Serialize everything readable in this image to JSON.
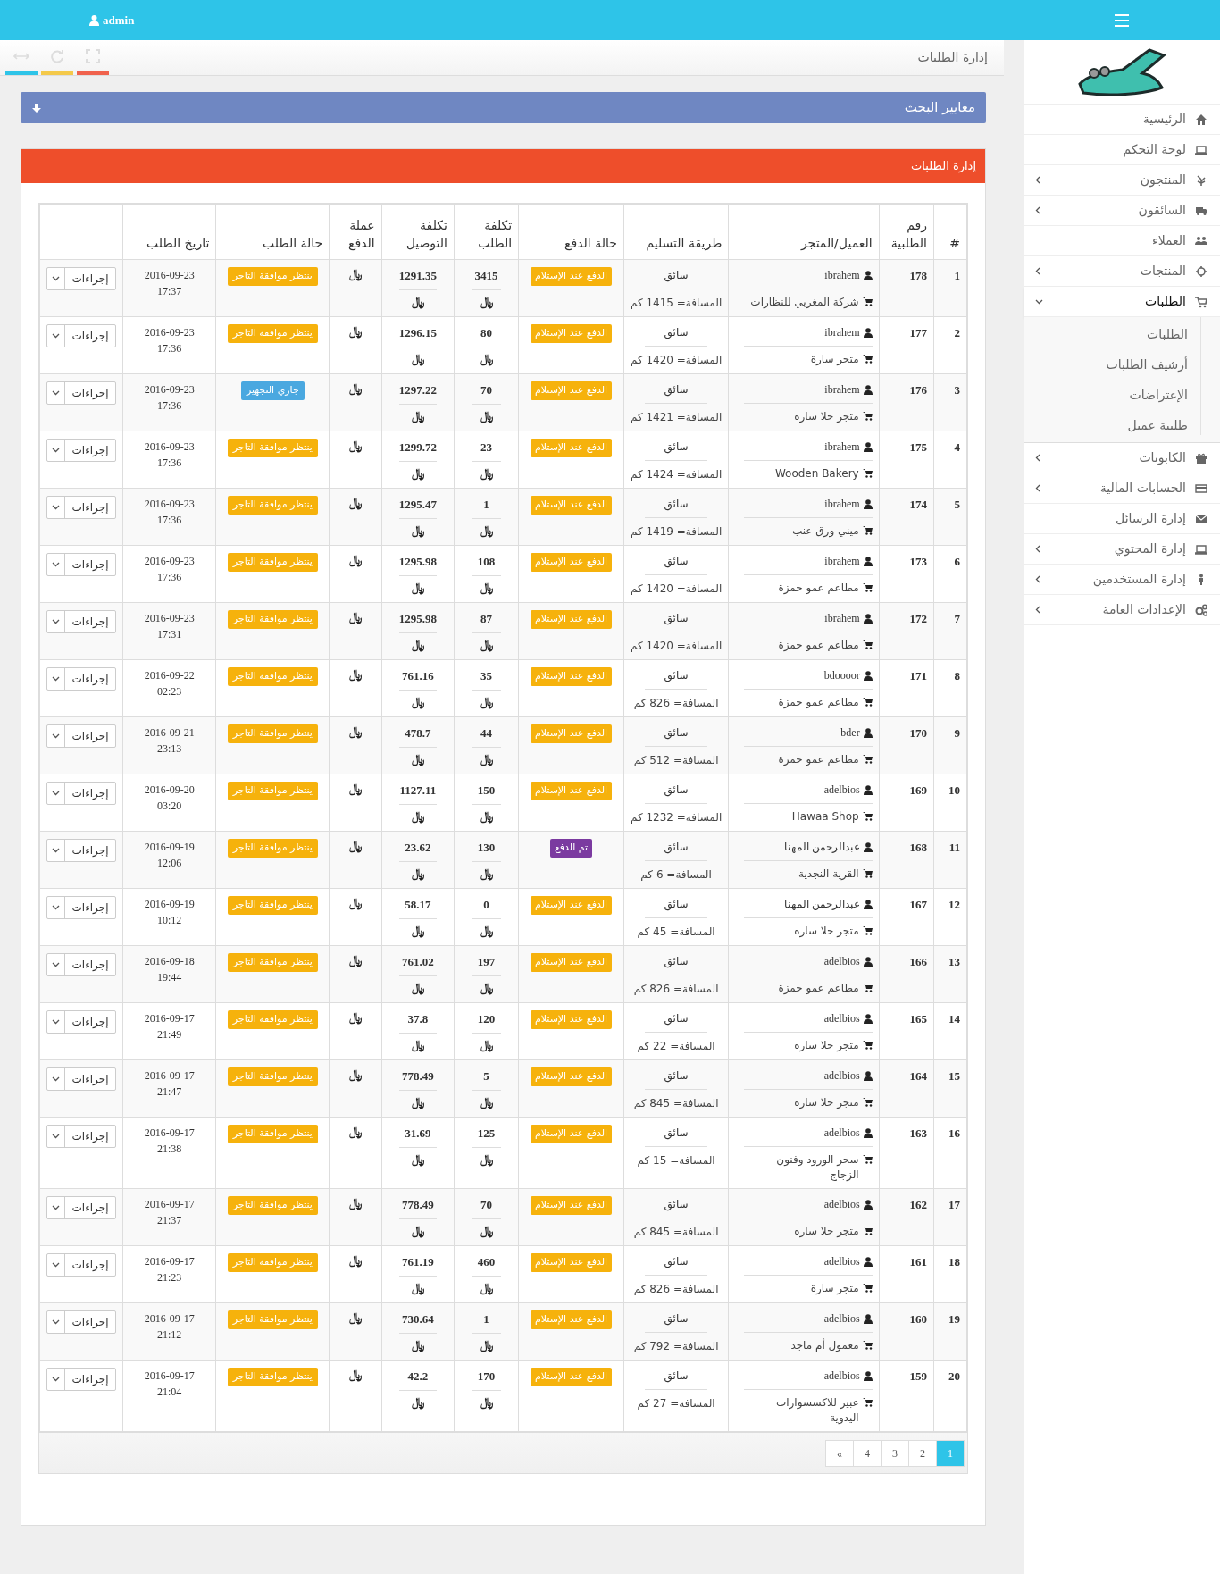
{
  "top_bar": {
    "user": "admin"
  },
  "breadcrumb": {
    "title": "إدارة الطلبات"
  },
  "search_panel": {
    "title": "معايير البحث"
  },
  "orders_panel": {
    "title": "إدارة الطلبات"
  },
  "table": {
    "columns": [
      "#",
      "رقم الطلبية",
      "العميل/المتجر",
      "طريقة التسليم",
      "حالة الدفع",
      "تكلفة الطلب",
      "تكلفة التوصيل",
      "عملة الدفع",
      "حالة الطلب",
      "تاريخ الطلب"
    ],
    "rows": [
      {
        "index": "1",
        "order_no": "178",
        "client": "ibrahem",
        "store": "شركة المغربي للنظارات",
        "method": "سائق",
        "distance": "المسافة= 1415 كم",
        "pay_status": {
          "text": "الدفع عند الإستلام",
          "color": "#f6b20c"
        },
        "order_cost": "3415",
        "order_currency": "﷼",
        "delivery_cost": "1291.35",
        "delivery_currency": "﷼",
        "currency": "﷼",
        "status": {
          "text": "ينتظر موافقة التاجر",
          "color": "#f6b20c"
        },
        "date": "2016-09-23",
        "time": "17:37",
        "action": "إجراءات"
      },
      {
        "index": "2",
        "order_no": "177",
        "client": "ibrahem",
        "store": "متجر سارة",
        "method": "سائق",
        "distance": "المسافة= 1420 كم",
        "pay_status": {
          "text": "الدفع عند الإستلام",
          "color": "#f6b20c"
        },
        "order_cost": "80",
        "order_currency": "﷼",
        "delivery_cost": "1296.15",
        "delivery_currency": "﷼",
        "currency": "﷼",
        "status": {
          "text": "ينتظر موافقة التاجر",
          "color": "#f6b20c"
        },
        "date": "2016-09-23",
        "time": "17:36",
        "action": "إجراءات"
      },
      {
        "index": "3",
        "order_no": "176",
        "client": "ibrahem",
        "store": "متجر حلا ساره",
        "method": "سائق",
        "distance": "المسافة= 1421 كم",
        "pay_status": {
          "text": "الدفع عند الإستلام",
          "color": "#f6b20c"
        },
        "order_cost": "70",
        "order_currency": "﷼",
        "delivery_cost": "1297.22",
        "delivery_currency": "﷼",
        "currency": "﷼",
        "status": {
          "text": "جاري التجهيز",
          "color": "#4aa8e0"
        },
        "date": "2016-09-23",
        "time": "17:36",
        "action": "إجراءات"
      },
      {
        "index": "4",
        "order_no": "175",
        "client": "ibrahem",
        "store": "Wooden Bakery",
        "method": "سائق",
        "distance": "المسافة= 1424 كم",
        "pay_status": {
          "text": "الدفع عند الإستلام",
          "color": "#f6b20c"
        },
        "order_cost": "23",
        "order_currency": "﷼",
        "delivery_cost": "1299.72",
        "delivery_currency": "﷼",
        "currency": "﷼",
        "status": {
          "text": "ينتظر موافقة التاجر",
          "color": "#f6b20c"
        },
        "date": "2016-09-23",
        "time": "17:36",
        "action": "إجراءات"
      },
      {
        "index": "5",
        "order_no": "174",
        "client": "ibrahem",
        "store": "ميني ورق عنب",
        "method": "سائق",
        "distance": "المسافة= 1419 كم",
        "pay_status": {
          "text": "الدفع عند الإستلام",
          "color": "#f6b20c"
        },
        "order_cost": "1",
        "order_currency": "﷼",
        "delivery_cost": "1295.47",
        "delivery_currency": "﷼",
        "currency": "﷼",
        "status": {
          "text": "ينتظر موافقة التاجر",
          "color": "#f6b20c"
        },
        "date": "2016-09-23",
        "time": "17:36",
        "action": "إجراءات"
      },
      {
        "index": "6",
        "order_no": "173",
        "client": "ibrahem",
        "store": "مطاعم عمو حمزة",
        "method": "سائق",
        "distance": "المسافة= 1420 كم",
        "pay_status": {
          "text": "الدفع عند الإستلام",
          "color": "#f6b20c"
        },
        "order_cost": "108",
        "order_currency": "﷼",
        "delivery_cost": "1295.98",
        "delivery_currency": "﷼",
        "currency": "﷼",
        "status": {
          "text": "ينتظر موافقة التاجر",
          "color": "#f6b20c"
        },
        "date": "2016-09-23",
        "time": "17:36",
        "action": "إجراءات"
      },
      {
        "index": "7",
        "order_no": "172",
        "client": "ibrahem",
        "store": "مطاعم عمو حمزة",
        "method": "سائق",
        "distance": "المسافة= 1420 كم",
        "pay_status": {
          "text": "الدفع عند الإستلام",
          "color": "#f6b20c"
        },
        "order_cost": "87",
        "order_currency": "﷼",
        "delivery_cost": "1295.98",
        "delivery_currency": "﷼",
        "currency": "﷼",
        "status": {
          "text": "ينتظر موافقة التاجر",
          "color": "#f6b20c"
        },
        "date": "2016-09-23",
        "time": "17:31",
        "action": "إجراءات"
      },
      {
        "index": "8",
        "order_no": "171",
        "client": "bdoooor",
        "store": "مطاعم عمو حمزة",
        "method": "سائق",
        "distance": "المسافة= 826 كم",
        "pay_status": {
          "text": "الدفع عند الإستلام",
          "color": "#f6b20c"
        },
        "order_cost": "35",
        "order_currency": "﷼",
        "delivery_cost": "761.16",
        "delivery_currency": "﷼",
        "currency": "﷼",
        "status": {
          "text": "ينتظر موافقة التاجر",
          "color": "#f6b20c"
        },
        "date": "2016-09-22",
        "time": "02:23",
        "action": "إجراءات"
      },
      {
        "index": "9",
        "order_no": "170",
        "client": "bder",
        "store": "مطاعم عمو حمزة",
        "method": "سائق",
        "distance": "المسافة= 512 كم",
        "pay_status": {
          "text": "الدفع عند الإستلام",
          "color": "#f6b20c"
        },
        "order_cost": "44",
        "order_currency": "﷼",
        "delivery_cost": "478.7",
        "delivery_currency": "﷼",
        "currency": "﷼",
        "status": {
          "text": "ينتظر موافقة التاجر",
          "color": "#f6b20c"
        },
        "date": "2016-09-21",
        "time": "23:13",
        "action": "إجراءات"
      },
      {
        "index": "10",
        "order_no": "169",
        "client": "adelbios",
        "store": "Hawaa Shop",
        "method": "سائق",
        "distance": "المسافة= 1232 كم",
        "pay_status": {
          "text": "الدفع عند الإستلام",
          "color": "#f6b20c"
        },
        "order_cost": "150",
        "order_currency": "﷼",
        "delivery_cost": "1127.11",
        "delivery_currency": "﷼",
        "currency": "﷼",
        "status": {
          "text": "ينتظر موافقة التاجر",
          "color": "#f6b20c"
        },
        "date": "2016-09-20",
        "time": "03:20",
        "action": "إجراءات"
      },
      {
        "index": "11",
        "order_no": "168",
        "client": "عبدالرحمن المهنا",
        "store": "القرية النجدية",
        "method": "سائق",
        "distance": "المسافة= 6 كم",
        "pay_status": {
          "text": "تم الدفع",
          "color": "#7b3aa0"
        },
        "order_cost": "130",
        "order_currency": "﷼",
        "delivery_cost": "23.62",
        "delivery_currency": "﷼",
        "currency": "﷼",
        "status": {
          "text": "ينتظر موافقة التاجر",
          "color": "#f6b20c"
        },
        "date": "2016-09-19",
        "time": "12:06",
        "action": "إجراءات"
      },
      {
        "index": "12",
        "order_no": "167",
        "client": "عبدالرحمن المهنا",
        "store": "متجر حلا ساره",
        "method": "سائق",
        "distance": "المسافة= 45 كم",
        "pay_status": {
          "text": "الدفع عند الإستلام",
          "color": "#f6b20c"
        },
        "order_cost": "0",
        "order_currency": "﷼",
        "delivery_cost": "58.17",
        "delivery_currency": "﷼",
        "currency": "﷼",
        "status": {
          "text": "ينتظر موافقة التاجر",
          "color": "#f6b20c"
        },
        "date": "2016-09-19",
        "time": "10:12",
        "action": "إجراءات"
      },
      {
        "index": "13",
        "order_no": "166",
        "client": "adelbios",
        "store": "مطاعم عمو حمزة",
        "method": "سائق",
        "distance": "المسافة= 826 كم",
        "pay_status": {
          "text": "الدفع عند الإستلام",
          "color": "#f6b20c"
        },
        "order_cost": "197",
        "order_currency": "﷼",
        "delivery_cost": "761.02",
        "delivery_currency": "﷼",
        "currency": "﷼",
        "status": {
          "text": "ينتظر موافقة التاجر",
          "color": "#f6b20c"
        },
        "date": "2016-09-18",
        "time": "19:44",
        "action": "إجراءات"
      },
      {
        "index": "14",
        "order_no": "165",
        "client": "adelbios",
        "store": "متجر حلا ساره",
        "method": "سائق",
        "distance": "المسافة= 22 كم",
        "pay_status": {
          "text": "الدفع عند الإستلام",
          "color": "#f6b20c"
        },
        "order_cost": "120",
        "order_currency": "﷼",
        "delivery_cost": "37.8",
        "delivery_currency": "﷼",
        "currency": "﷼",
        "status": {
          "text": "ينتظر موافقة التاجر",
          "color": "#f6b20c"
        },
        "date": "2016-09-17",
        "time": "21:49",
        "action": "إجراءات"
      },
      {
        "index": "15",
        "order_no": "164",
        "client": "adelbios",
        "store": "متجر حلا ساره",
        "method": "سائق",
        "distance": "المسافة= 845 كم",
        "pay_status": {
          "text": "الدفع عند الإستلام",
          "color": "#f6b20c"
        },
        "order_cost": "5",
        "order_currency": "﷼",
        "delivery_cost": "778.49",
        "delivery_currency": "﷼",
        "currency": "﷼",
        "status": {
          "text": "ينتظر موافقة التاجر",
          "color": "#f6b20c"
        },
        "date": "2016-09-17",
        "time": "21:47",
        "action": "إجراءات"
      },
      {
        "index": "16",
        "order_no": "163",
        "client": "adelbios",
        "store": "سحر الورود وفنون الزجاج",
        "method": "سائق",
        "distance": "المسافة= 15 كم",
        "pay_status": {
          "text": "الدفع عند الإستلام",
          "color": "#f6b20c"
        },
        "order_cost": "125",
        "order_currency": "﷼",
        "delivery_cost": "31.69",
        "delivery_currency": "﷼",
        "currency": "﷼",
        "status": {
          "text": "ينتظر موافقة التاجر",
          "color": "#f6b20c"
        },
        "date": "2016-09-17",
        "time": "21:38",
        "action": "إجراءات"
      },
      {
        "index": "17",
        "order_no": "162",
        "client": "adelbios",
        "store": "متجر حلا ساره",
        "method": "سائق",
        "distance": "المسافة= 845 كم",
        "pay_status": {
          "text": "الدفع عند الإستلام",
          "color": "#f6b20c"
        },
        "order_cost": "70",
        "order_currency": "﷼",
        "delivery_cost": "778.49",
        "delivery_currency": "﷼",
        "currency": "﷼",
        "status": {
          "text": "ينتظر موافقة التاجر",
          "color": "#f6b20c"
        },
        "date": "2016-09-17",
        "time": "21:37",
        "action": "إجراءات"
      },
      {
        "index": "18",
        "order_no": "161",
        "client": "adelbios",
        "store": "متجر سارة",
        "method": "سائق",
        "distance": "المسافة= 826 كم",
        "pay_status": {
          "text": "الدفع عند الإستلام",
          "color": "#f6b20c"
        },
        "order_cost": "460",
        "order_currency": "﷼",
        "delivery_cost": "761.19",
        "delivery_currency": "﷼",
        "currency": "﷼",
        "status": {
          "text": "ينتظر موافقة التاجر",
          "color": "#f6b20c"
        },
        "date": "2016-09-17",
        "time": "21:23",
        "action": "إجراءات"
      },
      {
        "index": "19",
        "order_no": "160",
        "client": "adelbios",
        "store": "معمول أم ماجد",
        "method": "سائق",
        "distance": "المسافة= 792 كم",
        "pay_status": {
          "text": "الدفع عند الإستلام",
          "color": "#f6b20c"
        },
        "order_cost": "1",
        "order_currency": "﷼",
        "delivery_cost": "730.64",
        "delivery_currency": "﷼",
        "currency": "﷼",
        "status": {
          "text": "ينتظر موافقة التاجر",
          "color": "#f6b20c"
        },
        "date": "2016-09-17",
        "time": "21:12",
        "action": "إجراءات"
      },
      {
        "index": "20",
        "order_no": "159",
        "client": "adelbios",
        "store": "عبير للاكسسوارات اليدوية",
        "method": "سائق",
        "distance": "المسافة= 27 كم",
        "pay_status": {
          "text": "الدفع عند الإستلام",
          "color": "#f6b20c"
        },
        "order_cost": "170",
        "order_currency": "﷼",
        "delivery_cost": "42.2",
        "delivery_currency": "﷼",
        "currency": "﷼",
        "status": {
          "text": "ينتظر موافقة التاجر",
          "color": "#f6b20c"
        },
        "date": "2016-09-17",
        "time": "21:04",
        "action": "إجراءات"
      }
    ]
  },
  "pagination": [
    {
      "label": "1",
      "selected": true
    },
    {
      "label": "2",
      "selected": false
    },
    {
      "label": "3",
      "selected": false
    },
    {
      "label": "4",
      "selected": false
    },
    {
      "label": "»",
      "selected": false
    }
  ],
  "sidebar": {
    "items": [
      {
        "label": "الرئيسية",
        "expandable": false,
        "selected": false
      },
      {
        "label": "لوحة التحكم",
        "expandable": false,
        "selected": false
      },
      {
        "label": "المنتجون",
        "expandable": true,
        "expanded": false,
        "selected": false
      },
      {
        "label": "السائقون",
        "expandable": true,
        "expanded": false,
        "selected": false
      },
      {
        "label": "العملاء",
        "expandable": false,
        "selected": false
      },
      {
        "label": "المنتجات",
        "expandable": true,
        "expanded": false,
        "selected": false
      },
      {
        "label": "الطلبات",
        "expandable": true,
        "expanded": true,
        "selected": true,
        "children": [
          {
            "label": "الطلبات"
          },
          {
            "label": "أرشيف الطلبات"
          },
          {
            "label": "الإعتراضات"
          },
          {
            "label": "طلبية عميل"
          }
        ]
      },
      {
        "label": "الكابونات",
        "expandable": true,
        "expanded": false,
        "selected": false
      },
      {
        "label": "الحسابات المالية",
        "expandable": true,
        "expanded": false,
        "selected": false
      },
      {
        "label": "إدارة الرسائل",
        "expandable": false,
        "selected": false
      },
      {
        "label": "إدارة المحتوي",
        "expandable": true,
        "expanded": false,
        "selected": false
      },
      {
        "label": "إدارة المستخدمين",
        "expandable": true,
        "expanded": false,
        "selected": false
      },
      {
        "label": "الإعدادات العامة",
        "expandable": true,
        "expanded": false,
        "selected": false
      }
    ]
  }
}
